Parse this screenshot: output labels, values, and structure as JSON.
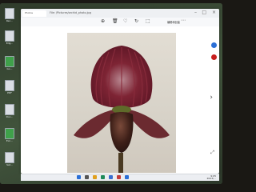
{
  "desktop": {
    "icons": [
      {
        "label": "Rec..."
      },
      {
        "label": "Edg..."
      },
      {
        "label": "Go..."
      },
      {
        "label": "PDF"
      },
      {
        "label": "Doc..."
      },
      {
        "label": "Exc..."
      },
      {
        "label": "Set..."
      }
    ]
  },
  "window": {
    "tab_title": "Photos",
    "url": "File: /Pictures/orchid_photo.jpg",
    "minimize": "–",
    "maximize": "□",
    "close": "×"
  },
  "toolbar": {
    "zoom_in": "⊕",
    "delete": "🗑",
    "favorite": "♡",
    "rotate": "↻",
    "crop": "⬚",
    "edit_label": "编辑和创建",
    "more": "⋯"
  },
  "viewer": {
    "next": "›",
    "expand": "⤢"
  },
  "taskbar": {
    "time": "9:05",
    "date": "2023/..."
  },
  "colors": {
    "accent": "#2b6fd6",
    "red_dot": "#c81e1e",
    "petal": "#6a1f2e",
    "sepal_stripe": "#8a2d3d"
  }
}
